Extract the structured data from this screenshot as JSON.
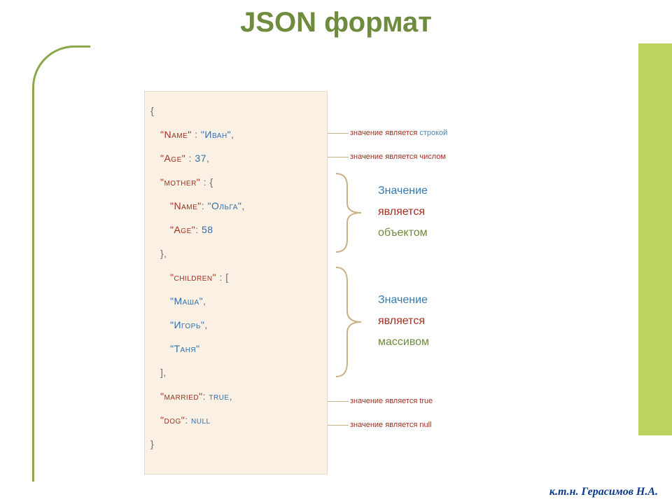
{
  "title": "JSON формат",
  "footer": "к.т.н. Герасимов Н.А.",
  "code": {
    "open": "{",
    "close": "}",
    "k_name": "\"Name\"",
    "v_name": "\"Иван\"",
    "k_age": "\"Age\"",
    "v_age": "37",
    "k_mother": "\"mother\"",
    "mother_open": "{",
    "mother_k_name": "\"Name\"",
    "mother_v_name": "\"Ольга\"",
    "mother_k_age": "\"Age\"",
    "mother_v_age": "58",
    "mother_close": "},",
    "k_children": "\"children\"",
    "children_open": "[",
    "child1": "\"Маша\"",
    "child2": "\"Игорь\"",
    "child3": "\"Таня\"",
    "children_close": "],",
    "k_married": "\"married\"",
    "v_married": "true",
    "k_dog": "\"dog\"",
    "v_dog": "null"
  },
  "ann": {
    "string_prefix": "значение является ",
    "string_sub": "строкой",
    "number": "значение является числом",
    "object": [
      "Значение",
      "является",
      "объектом"
    ],
    "array": [
      "Значение",
      "является",
      "массивом"
    ],
    "true": "значение является true",
    "null": "значение является null"
  }
}
